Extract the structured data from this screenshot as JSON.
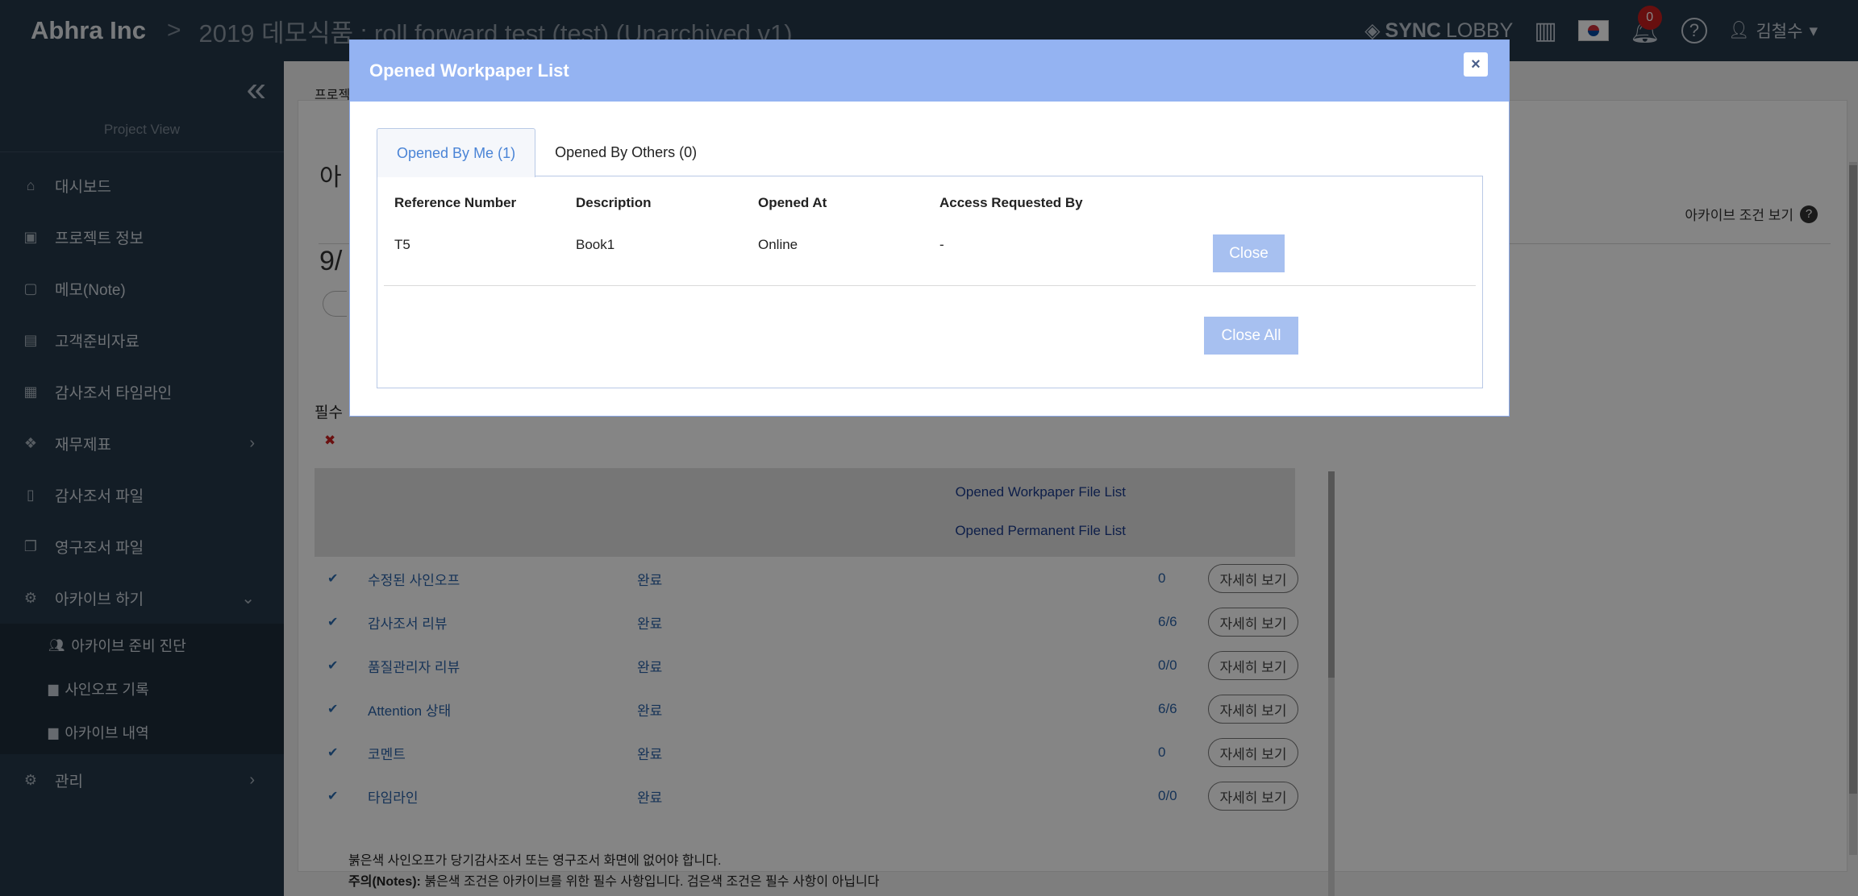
{
  "header": {
    "brand": "Abhra Inc",
    "separator": ">",
    "project_title": "2019 데모식품 : roll forward test (test) (Unarchived v1)",
    "sync_bold": "SYNC",
    "sync_light": "LOBBY",
    "notification_count": "0",
    "help_glyph": "?",
    "user_name": "김철수"
  },
  "sidebar": {
    "project_view": "Project View",
    "items": [
      {
        "label": "대시보드",
        "icon": "home-icon"
      },
      {
        "label": "프로젝트 정보",
        "icon": "id-card-icon"
      },
      {
        "label": "메모(Note)",
        "icon": "note-icon"
      },
      {
        "label": "고객준비자료",
        "icon": "folder-icon"
      },
      {
        "label": "감사조서 타임라인",
        "icon": "calendar-icon"
      },
      {
        "label": "재무제표",
        "icon": "cubes-icon"
      },
      {
        "label": "감사조서 파일",
        "icon": "file-icon"
      },
      {
        "label": "영구조서 파일",
        "icon": "files-icon"
      },
      {
        "label": "아카이브 하기",
        "icon": "gear-icon"
      }
    ],
    "sub_items": [
      {
        "label": "아카이브 준비 진단",
        "icon": "users-icon"
      },
      {
        "label": "사인오프 기록",
        "icon": "archive-box-icon"
      },
      {
        "label": "아카이브 내역",
        "icon": "archive-box-icon"
      }
    ],
    "manage": {
      "label": "관리",
      "icon": "gear-icon"
    }
  },
  "main": {
    "breadcrumb": "프로젝트",
    "heading": "아",
    "archive_conditions": "아카이브 조건 보기",
    "date_fragment": "9/",
    "section_label": "필수",
    "gray_links": [
      "Opened Workpaper File List",
      "Opened Permanent File List"
    ],
    "rows": [
      {
        "name": "수정된 사인오프",
        "status": "완료",
        "count": "0",
        "button": "자세히 보기"
      },
      {
        "name": "감사조서 리뷰",
        "status": "완료",
        "count": "6/6",
        "button": "자세히 보기"
      },
      {
        "name": "품질관리자 리뷰",
        "status": "완료",
        "count": "0/0",
        "button": "자세히 보기"
      },
      {
        "name": "Attention 상태",
        "status": "완료",
        "count": "6/6",
        "button": "자세히 보기"
      },
      {
        "name": "코멘트",
        "status": "완료",
        "count": "0",
        "button": "자세히 보기"
      },
      {
        "name": "타임라인",
        "status": "완료",
        "count": "0/0",
        "button": "자세히 보기"
      }
    ],
    "note_line1": "붉은색 사인오프가 당기감사조서 또는 영구조서 화면에 없어야 합니다.",
    "note_label": "주의(Notes):",
    "note_line2": "붉은색 조건은 아카이브를 위한 필수 사항입니다. 검은색 조건은 필수 사항이 아닙니다"
  },
  "modal": {
    "title": "Opened Workpaper List",
    "close_glyph": "×",
    "tabs": [
      {
        "label": "Opened By Me (1)",
        "active": true
      },
      {
        "label": "Opened By Others (0)",
        "active": false
      }
    ],
    "columns": [
      "Reference Number",
      "Description",
      "Opened At",
      "Access Requested By"
    ],
    "row": {
      "ref": "T5",
      "description": "Book1",
      "opened_at": "Online",
      "access_requested_by": "-"
    },
    "close_label": "Close",
    "close_all_label": "Close All"
  }
}
